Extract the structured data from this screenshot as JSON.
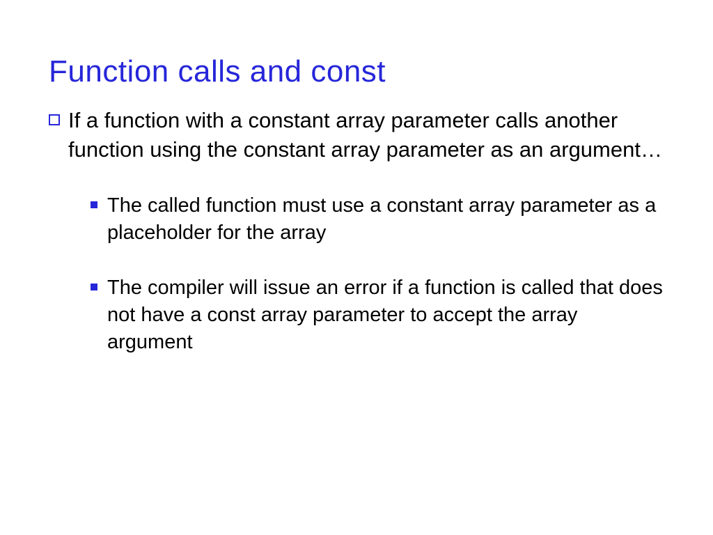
{
  "slide": {
    "title": "Function calls and const",
    "bullets": [
      {
        "text": "If a function with a constant array parameter calls another function using the constant array parameter as an argument…",
        "sub": [
          {
            "text": "The called function must use a constant  array parameter as a placeholder for the array"
          },
          {
            "text": "The compiler will issue an error if a function is called that does not have a const array parameter to accept the array argument"
          }
        ]
      }
    ]
  }
}
